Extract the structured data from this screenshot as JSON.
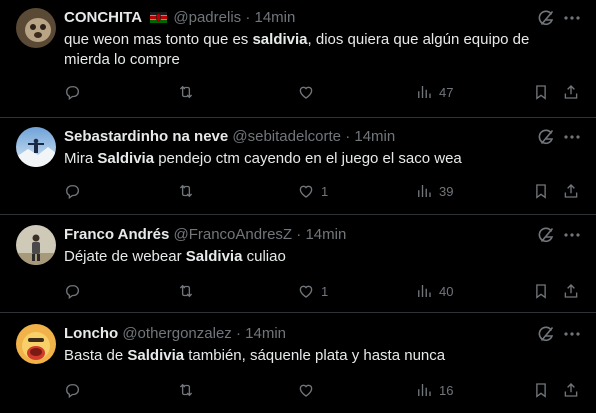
{
  "tweets": [
    {
      "name": "CONCHITA",
      "flag": "kenya-flag",
      "handle": "@padrelis",
      "dot": "·",
      "time": "14min",
      "text_parts": [
        "que weon mas tonto que es ",
        "saldivia",
        ", dios quiera que algún equipo de mierda lo compre"
      ],
      "replies": "",
      "retweets": "",
      "likes": "",
      "views": "47"
    },
    {
      "name": "Sebastardinho na neve",
      "handle": "@sebitadelcorte",
      "dot": "·",
      "time": "14min",
      "text_parts": [
        "Mira ",
        "Saldivia",
        " pendejo ctm cayendo en el juego el saco wea"
      ],
      "replies": "",
      "retweets": "",
      "likes": "1",
      "views": "39"
    },
    {
      "name": "Franco Andrés",
      "handle": "@FrancoAndresZ",
      "dot": "·",
      "time": "14min",
      "text_parts": [
        "Déjate de webear ",
        "Saldivia",
        " culiao"
      ],
      "replies": "",
      "retweets": "",
      "likes": "1",
      "views": "40"
    },
    {
      "name": "Loncho",
      "handle": "@othergonzalez",
      "dot": "·",
      "time": "14min",
      "text_parts": [
        "Basta de ",
        "Saldivia",
        " también, sáquenle plata y hasta nunca"
      ],
      "replies": "",
      "retweets": "",
      "likes": "",
      "views": "16"
    }
  ],
  "colors": {
    "background": "#000000",
    "text": "#e7e9ea",
    "muted": "#71767b",
    "divider": "#2f3336"
  },
  "icons": [
    "reply-icon",
    "retweet-icon",
    "like-icon",
    "views-icon",
    "bookmark-icon",
    "share-icon",
    "grok-icon",
    "more-icon"
  ]
}
